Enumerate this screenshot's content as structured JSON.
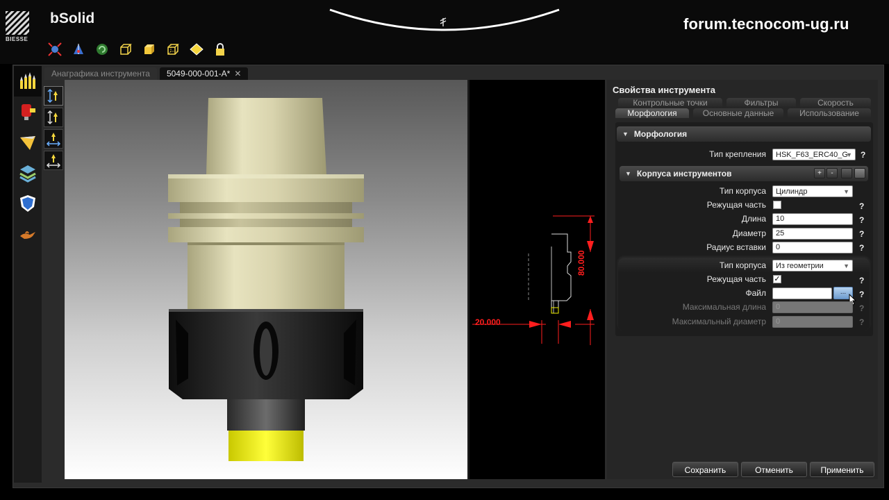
{
  "app": {
    "brand": "BIESSE",
    "title": "bSolid",
    "watermark": "forum.tecnocom-ug.ru"
  },
  "toolbar": {
    "icons": [
      "zoom-fit-icon",
      "axis-view-icon",
      "refresh-icon",
      "wireframe-cube-icon",
      "solid-cube-icon",
      "hidden-line-cube-icon",
      "top-view-diamond-icon",
      "lock-icon"
    ]
  },
  "leftbar": {
    "icons": [
      "tools-icon",
      "aggregate-icon",
      "blade-icon",
      "layers-icon",
      "shield-icon",
      "genie-lamp-icon"
    ]
  },
  "doc_tabs": [
    {
      "label": "Анаграфика инструмента",
      "active": false
    },
    {
      "label": "5049-000-001-A*",
      "active": true,
      "close": "✕"
    }
  ],
  "panel": {
    "title": "Свойства инструмента",
    "tabs_back": [
      "Контрольные точки",
      "Фильтры",
      "Скорость"
    ],
    "tabs_front": [
      "Морфология",
      "Основные данные",
      "Использование"
    ],
    "section1": {
      "title": "Морфология",
      "mount_label": "Тип крепления",
      "mount_value": "HSK_F63_ERC40_G"
    },
    "section2": {
      "title": "Корпуса инструментов",
      "buttons": [
        "+",
        "-"
      ],
      "body1": {
        "type_label": "Тип корпуса",
        "type_value": "Цилиндр",
        "cutting_label": "Режущая часть",
        "cutting_checked": false,
        "length_label": "Длина",
        "length_value": "10",
        "diameter_label": "Диаметр",
        "diameter_value": "25",
        "radius_label": "Радиус вставки",
        "radius_value": "0"
      },
      "body2": {
        "type_label": "Тип корпуса",
        "type_value": "Из геометрии",
        "cutting_label": "Режущая часть",
        "cutting_mark": "✓",
        "file_label": "Файл",
        "file_value": "",
        "browse": "...",
        "maxlen_label": "Максимальная длина",
        "maxlen_value": "0",
        "maxdia_label": "Максимальный диаметр",
        "maxdia_value": "0"
      }
    },
    "help": "?",
    "actions": {
      "save": "Сохранить",
      "cancel": "Отменить",
      "apply": "Применить"
    }
  },
  "drawing2d": {
    "dim_width": "20.000",
    "dim_height": "80.000"
  },
  "colors": {
    "holder": "#d6d1a8",
    "collet_nut": "#1f1f1f",
    "tip": "#f0f000",
    "dimension": "#ff1e1e",
    "browse_button": "#8fb6e0"
  }
}
